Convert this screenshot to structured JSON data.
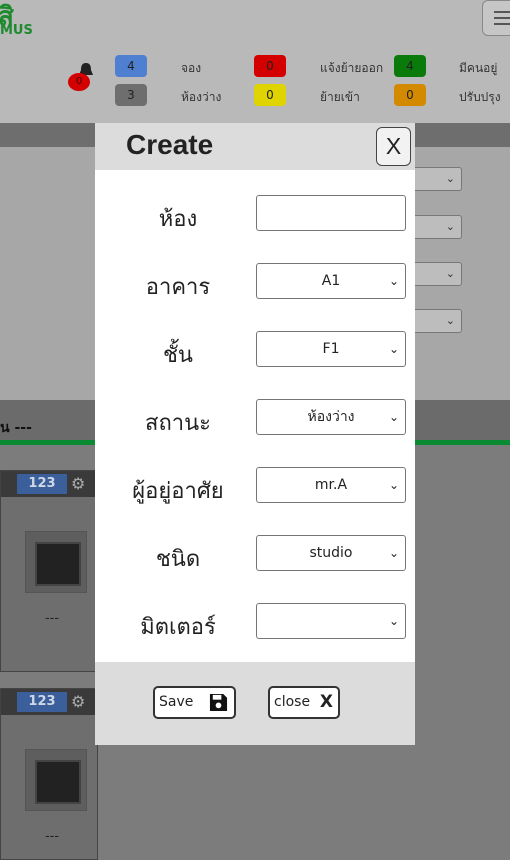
{
  "header": {
    "logo_text": "สิ",
    "logo_sub": "MUS",
    "bell_count": "0",
    "stats": [
      {
        "count": "4",
        "label": "จอง",
        "color": "#4f7fd1"
      },
      {
        "count": "3",
        "label": "ห้องว่าง",
        "color": "#6e6e6e"
      },
      {
        "count": "0",
        "label": "แจ้งย้ายออก",
        "color": "#d40000"
      },
      {
        "count": "0",
        "label": "ย้ายเข้า",
        "color": "#e0d400"
      },
      {
        "count": "4",
        "label": "มีคนอยู่",
        "color": "#0a7a0a"
      },
      {
        "count": "0",
        "label": "ปรับปรุง",
        "color": "#d48a00"
      }
    ]
  },
  "background": {
    "section_text": "น ---",
    "cards": [
      {
        "number": "123",
        "caption": "---"
      },
      {
        "number": "123",
        "caption": "---"
      }
    ]
  },
  "modal": {
    "title": "Create",
    "close_x": "X",
    "fields": {
      "room": {
        "label": "ห้อง",
        "value": ""
      },
      "building": {
        "label": "อาคาร",
        "value": "A1"
      },
      "floor": {
        "label": "ชั้น",
        "value": "F1"
      },
      "status": {
        "label": "สถานะ",
        "value": "ห้องว่าง"
      },
      "resident": {
        "label": "ผู้อยู่อาศัย",
        "value": "mr.A"
      },
      "type": {
        "label": "ชนิด",
        "value": "studio"
      },
      "meter": {
        "label": "มิตเตอร์",
        "value": ""
      }
    },
    "save_label": "Save",
    "close_label": "close",
    "close_icon_glyph": "X"
  }
}
